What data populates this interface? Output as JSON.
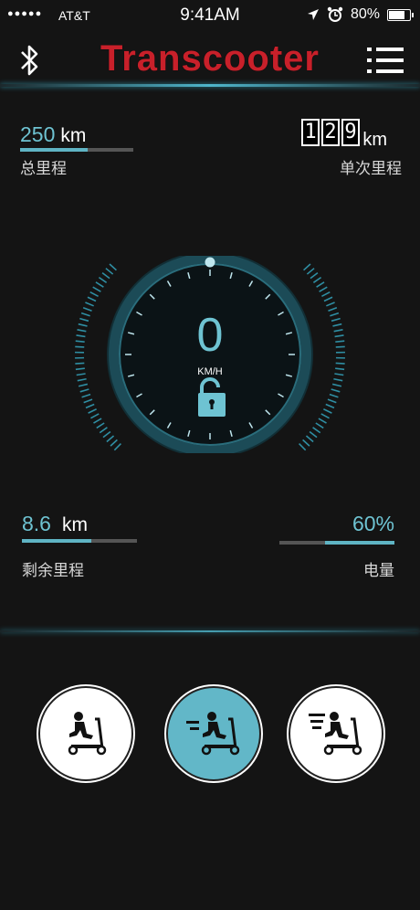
{
  "status_bar": {
    "signal_dots": "●●●●●",
    "carrier": "AT&T",
    "time": "9:41AM",
    "battery": "80%"
  },
  "header": {
    "title": "Transcooter"
  },
  "total_distance": {
    "value": "250",
    "unit": "km",
    "label": "总里程",
    "progress": 0.6
  },
  "trip_distance": {
    "digits": [
      "1",
      "2",
      "9"
    ],
    "unit": "km",
    "label": "单次里程"
  },
  "speedometer": {
    "speed": "0",
    "unit": "KM/H",
    "locked": false
  },
  "remaining_range": {
    "value": "8.6",
    "unit": "km",
    "label": "剩余里程",
    "progress": 0.6
  },
  "battery_level": {
    "value": "60%",
    "label": "电量",
    "progress": 0.6
  },
  "modes": [
    {
      "name": "slow",
      "active": false
    },
    {
      "name": "medium",
      "active": true
    },
    {
      "name": "fast",
      "active": false
    }
  ],
  "colors": {
    "accent": "#62b7c8",
    "title_red": "#c8202a",
    "background": "#141414"
  }
}
